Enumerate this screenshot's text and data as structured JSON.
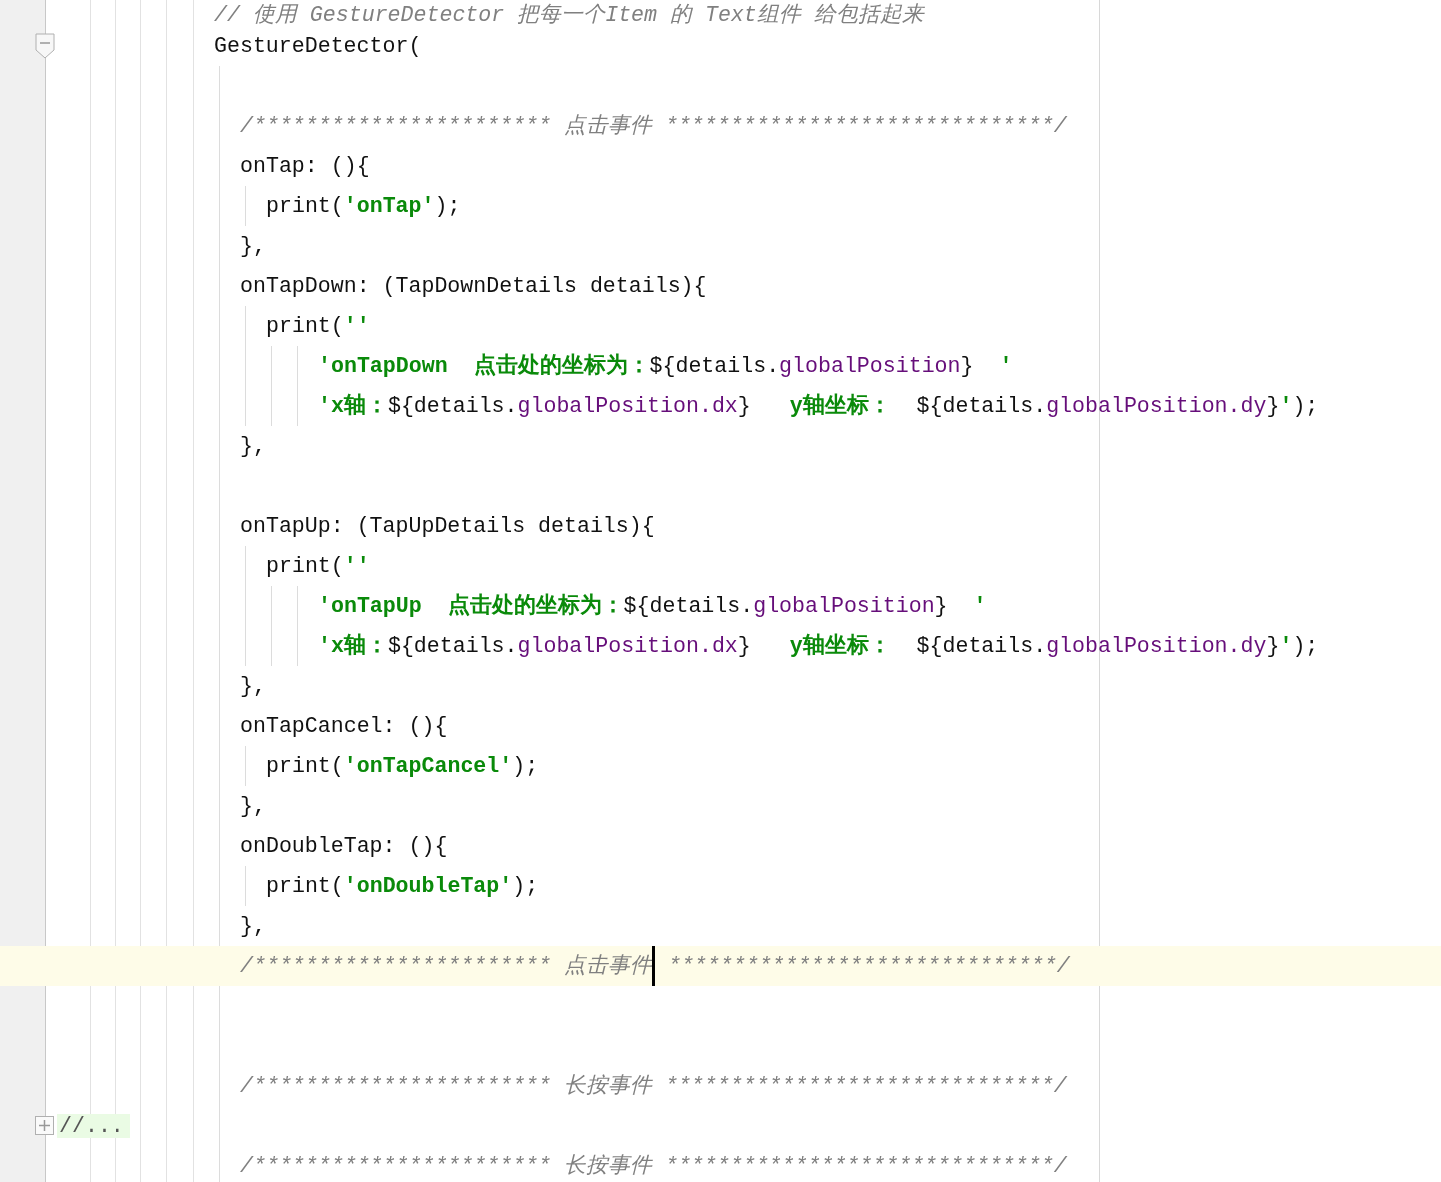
{
  "editor": {
    "lines": [
      {
        "tokens": [
          {
            "text": "// 使用 GestureDetector 把每一个Item 的 Text组件 给包括起来",
            "kind": "comment"
          }
        ],
        "current": false
      },
      {
        "tokens": [
          {
            "text": "GestureDetector(",
            "kind": "plain"
          }
        ],
        "expanded": true,
        "current": false,
        "children": [
          {
            "current": false
          },
          {
            "tokens": [
              {
                "text": "/*********************** 点击事件 ******************************/",
                "kind": "comment"
              }
            ],
            "current": false
          },
          {
            "tokens": [
              {
                "text": "onTap: (){",
                "kind": "plain"
              }
            ],
            "current": false,
            "children": [
              {
                "tokens": [
                  {
                    "text": "print(",
                    "kind": "plain"
                  },
                  {
                    "text": "'onTap'",
                    "kind": "string"
                  },
                  {
                    "text": ");",
                    "kind": "plain"
                  }
                ],
                "current": false
              }
            ]
          },
          {
            "tokens": [
              {
                "text": "},",
                "kind": "plain"
              }
            ],
            "current": false
          },
          {
            "tokens": [
              {
                "text": "onTapDown: (TapDownDetails details){",
                "kind": "plain"
              }
            ],
            "current": false,
            "children": [
              {
                "tokens": [
                  {
                    "text": "print(",
                    "kind": "plain"
                  },
                  {
                    "text": "''",
                    "kind": "string"
                  }
                ],
                "current": false,
                "children": [
                  {
                    "children": [
                      {
                        "tokens": [
                          {
                            "text": "'onTapDown  点击处的坐标为：",
                            "kind": "string"
                          },
                          {
                            "text": "${details.",
                            "kind": "plain"
                          },
                          {
                            "text": "globalPosition",
                            "kind": "field"
                          },
                          {
                            "text": "}",
                            "kind": "plain"
                          },
                          {
                            "text": "  '",
                            "kind": "string"
                          }
                        ],
                        "current": false
                      },
                      {
                        "tokens": [
                          {
                            "text": "'x轴：",
                            "kind": "string"
                          },
                          {
                            "text": "${details.",
                            "kind": "plain"
                          },
                          {
                            "text": "globalPosition.dx",
                            "kind": "field"
                          },
                          {
                            "text": "}",
                            "kind": "plain"
                          },
                          {
                            "text": "   y轴坐标：  ",
                            "kind": "string"
                          },
                          {
                            "text": "${details.",
                            "kind": "plain"
                          },
                          {
                            "text": "globalPosition.dy",
                            "kind": "field"
                          },
                          {
                            "text": "}",
                            "kind": "plain"
                          },
                          {
                            "text": "'",
                            "kind": "string"
                          },
                          {
                            "text": ");",
                            "kind": "plain"
                          }
                        ],
                        "current": false
                      }
                    ]
                  }
                ]
              }
            ]
          },
          {
            "tokens": [
              {
                "text": "},",
                "kind": "plain"
              }
            ],
            "current": false
          },
          {
            "current": false
          },
          {
            "tokens": [
              {
                "text": "onTapUp: (TapUpDetails details){",
                "kind": "plain"
              }
            ],
            "current": false,
            "children": [
              {
                "tokens": [
                  {
                    "text": "print(",
                    "kind": "plain"
                  },
                  {
                    "text": "''",
                    "kind": "string"
                  }
                ],
                "current": false,
                "children": [
                  {
                    "children": [
                      {
                        "tokens": [
                          {
                            "text": "'onTapUp  点击处的坐标为：",
                            "kind": "string"
                          },
                          {
                            "text": "${details.",
                            "kind": "plain"
                          },
                          {
                            "text": "globalPosition",
                            "kind": "field"
                          },
                          {
                            "text": "}",
                            "kind": "plain"
                          },
                          {
                            "text": "  '",
                            "kind": "string"
                          }
                        ],
                        "current": false
                      },
                      {
                        "tokens": [
                          {
                            "text": "'x轴：",
                            "kind": "string"
                          },
                          {
                            "text": "${details.",
                            "kind": "plain"
                          },
                          {
                            "text": "globalPosition.dx",
                            "kind": "field"
                          },
                          {
                            "text": "}",
                            "kind": "plain"
                          },
                          {
                            "text": "   y轴坐标：  ",
                            "kind": "string"
                          },
                          {
                            "text": "${details.",
                            "kind": "plain"
                          },
                          {
                            "text": "globalPosition.dy",
                            "kind": "field"
                          },
                          {
                            "text": "}",
                            "kind": "plain"
                          },
                          {
                            "text": "'",
                            "kind": "string"
                          },
                          {
                            "text": ");",
                            "kind": "plain"
                          }
                        ],
                        "current": false
                      }
                    ]
                  }
                ]
              }
            ]
          },
          {
            "tokens": [
              {
                "text": "},",
                "kind": "plain"
              }
            ],
            "current": false
          },
          {
            "tokens": [
              {
                "text": "onTapCancel: (){",
                "kind": "plain"
              }
            ],
            "current": false,
            "children": [
              {
                "tokens": [
                  {
                    "text": "print(",
                    "kind": "plain"
                  },
                  {
                    "text": "'onTapCancel'",
                    "kind": "string"
                  },
                  {
                    "text": ");",
                    "kind": "plain"
                  }
                ],
                "current": false
              }
            ]
          },
          {
            "tokens": [
              {
                "text": "},",
                "kind": "plain"
              }
            ],
            "current": false
          },
          {
            "tokens": [
              {
                "text": "onDoubleTap: (){",
                "kind": "plain"
              }
            ],
            "current": false,
            "children": [
              {
                "tokens": [
                  {
                    "text": "print(",
                    "kind": "plain"
                  },
                  {
                    "text": "'onDoubleTap'",
                    "kind": "string"
                  },
                  {
                    "text": ");",
                    "kind": "plain"
                  }
                ],
                "current": false
              }
            ]
          },
          {
            "tokens": [
              {
                "text": "},",
                "kind": "plain"
              }
            ],
            "current": false
          },
          {
            "tokens": [
              {
                "text": "/*********************** 点击事件",
                "kind": "comment",
                "cursor": true
              },
              {
                "text": " ******************************/",
                "kind": "comment"
              }
            ],
            "current": true
          },
          {
            "current": false
          },
          {
            "current": false
          },
          {
            "tokens": [
              {
                "text": "/*********************** 长按事件 ******************************/",
                "kind": "comment"
              }
            ],
            "current": false
          },
          {
            "kind": "folded",
            "tokens": [
              {
                "text": "//...",
                "kind": "folded"
              }
            ],
            "expanded": false,
            "current": false
          },
          {
            "tokens": [
              {
                "text": "/*********************** 长按事件 ******************************/",
                "kind": "comment"
              }
            ],
            "current": false
          }
        ]
      }
    ]
  }
}
